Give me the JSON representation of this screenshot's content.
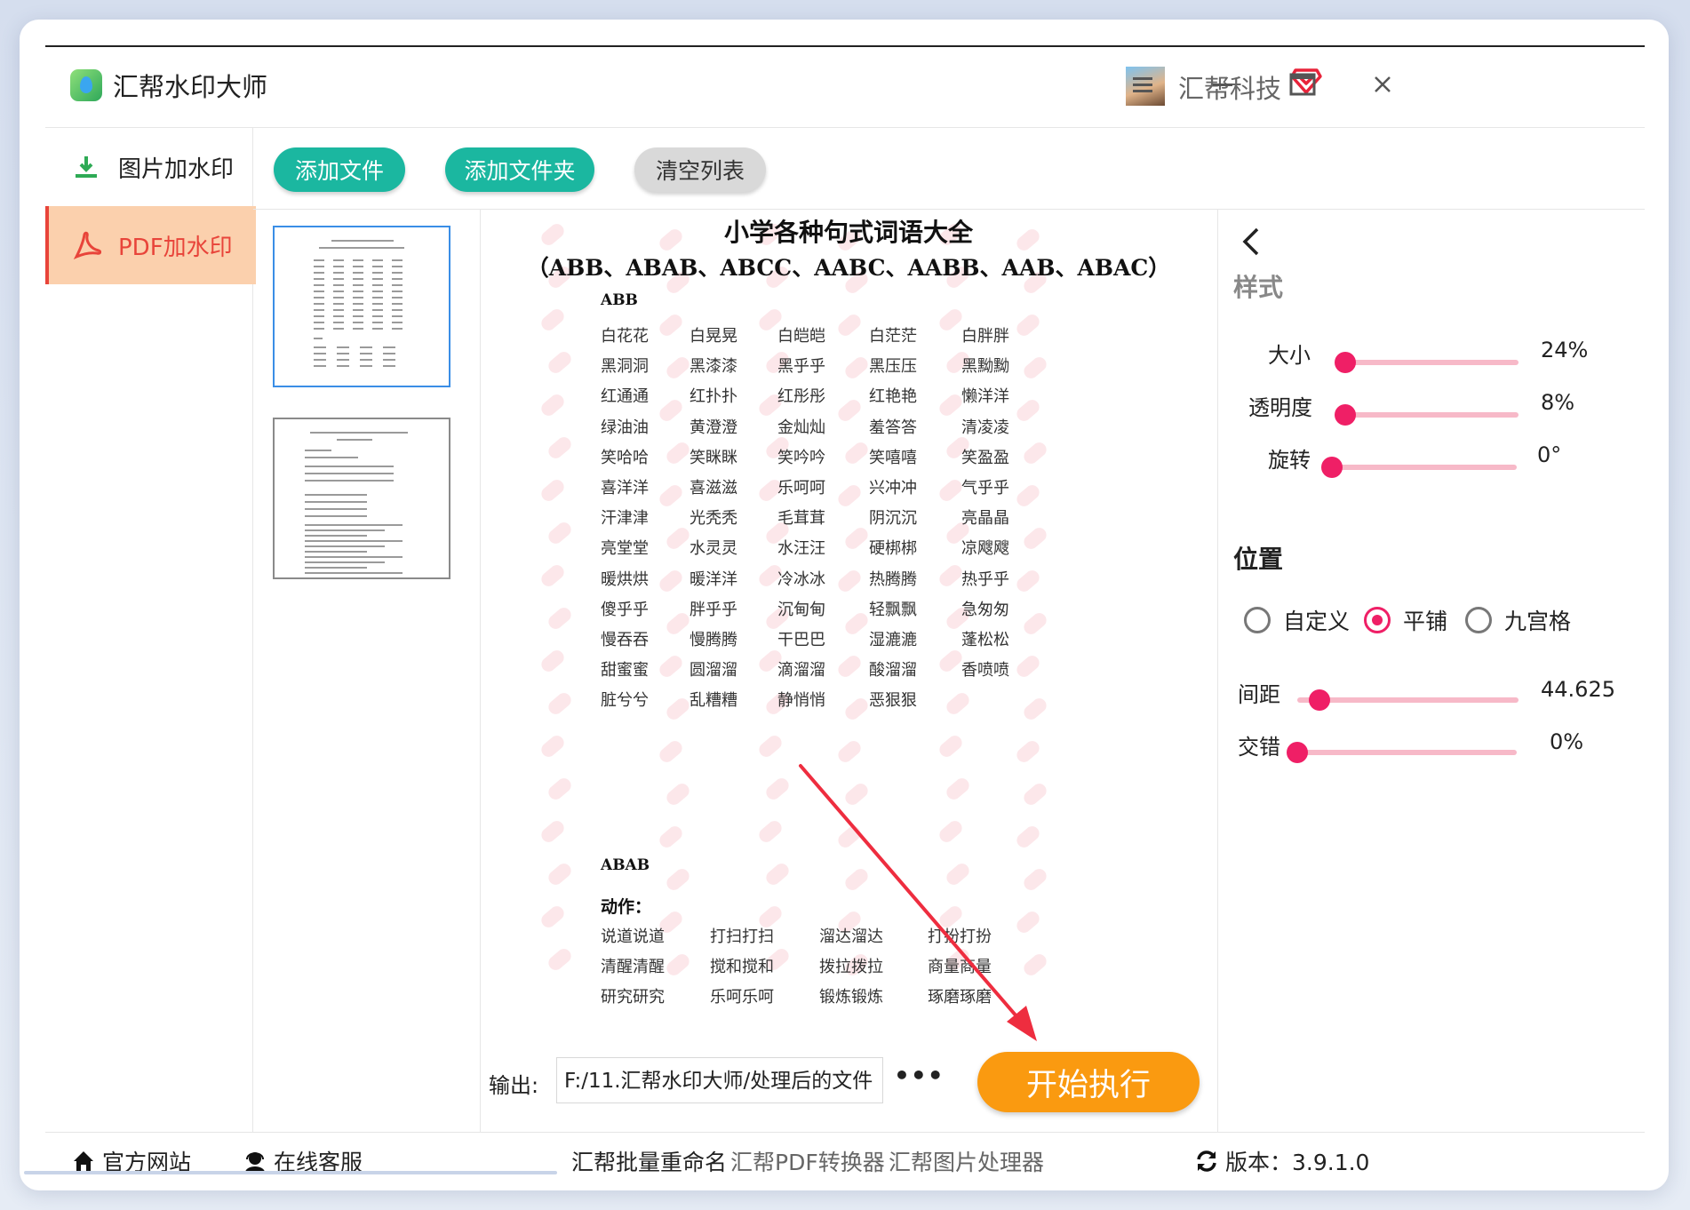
{
  "app": {
    "title": "汇帮水印大师"
  },
  "user": {
    "name": "汇帮科技"
  },
  "sidebar": {
    "items": [
      {
        "label": "图片加水印",
        "active": false
      },
      {
        "label": "PDF加水印",
        "active": true
      }
    ]
  },
  "toolbar": {
    "add_file": "添加文件",
    "add_folder": "添加文件夹",
    "clear_list": "清空列表"
  },
  "document": {
    "title": "小学各种句式词语大全",
    "subtitle": "（ABB、ABAB、ABCC、AABC、AABB、AAB、ABAC）",
    "section_abb": "ABB",
    "abb_words": [
      [
        "白花花",
        "白晃晃",
        "白皑皑",
        "白茫茫",
        "白胖胖"
      ],
      [
        "黑洞洞",
        "黑漆漆",
        "黑乎乎",
        "黑压压",
        "黑黝黝"
      ],
      [
        "红通通",
        "红扑扑",
        "红彤彤",
        "红艳艳",
        "懒洋洋"
      ],
      [
        "绿油油",
        "黄澄澄",
        "金灿灿",
        "羞答答",
        "清凌凌"
      ],
      [
        "笑哈哈",
        "笑眯眯",
        "笑吟吟",
        "笑嘻嘻",
        "笑盈盈"
      ],
      [
        "喜洋洋",
        "喜滋滋",
        "乐呵呵",
        "兴冲冲",
        "气乎乎"
      ],
      [
        "汗津津",
        "光秃秃",
        "毛茸茸",
        "阴沉沉",
        "亮晶晶"
      ],
      [
        "亮堂堂",
        "水灵灵",
        "水汪汪",
        "硬梆梆",
        "凉飕飕"
      ],
      [
        "暖烘烘",
        "暖洋洋",
        "冷冰冰",
        "热腾腾",
        "热乎乎"
      ],
      [
        "傻乎乎",
        "胖乎乎",
        "沉甸甸",
        "轻飘飘",
        "急匆匆"
      ],
      [
        "慢吞吞",
        "慢腾腾",
        "干巴巴",
        "湿漉漉",
        "蓬松松"
      ],
      [
        "甜蜜蜜",
        "圆溜溜",
        "滴溜溜",
        "酸溜溜",
        "香喷喷"
      ],
      [
        "脏兮兮",
        "乱糟糟",
        "静悄悄",
        "恶狠狠",
        ""
      ]
    ],
    "section_abab": "ABAB",
    "abab_sub": "动作：",
    "abab_words": [
      [
        "说道说道",
        "打扫打扫",
        "溜达溜达",
        "打扮打扮"
      ],
      [
        "清醒清醒",
        "搅和搅和",
        "拨拉拨拉",
        "商量商量"
      ],
      [
        "研究研究",
        "乐呵乐呵",
        "锻炼锻炼",
        "琢磨琢磨"
      ]
    ]
  },
  "output": {
    "label": "输出:",
    "path": "F:/11.汇帮水印大师/处理后的文件",
    "more": "•••",
    "start": "开始执行"
  },
  "settings": {
    "style_title": "样式",
    "size": {
      "label": "大小",
      "value": "24%",
      "fraction": 0.05
    },
    "opacity": {
      "label": "透明度",
      "value": "8%",
      "fraction": 0.06
    },
    "rotation": {
      "label": "旋转",
      "value": "0°",
      "fraction": 0.0
    },
    "position_title": "位置",
    "position_options": [
      {
        "label": "自定义",
        "selected": false
      },
      {
        "label": "平铺",
        "selected": true
      },
      {
        "label": "九宫格",
        "selected": false
      }
    ],
    "spacing": {
      "label": "间距",
      "value": "44.625",
      "fraction": 0.1
    },
    "stagger": {
      "label": "交错",
      "value": "0%",
      "fraction": 0.0
    }
  },
  "footer": {
    "website": "官方网站",
    "support": "在线客服",
    "link1": "汇帮批量重命名",
    "link2": "汇帮PDF转换器",
    "link3": "汇帮图片处理器",
    "version": "版本：3.9.1.0"
  },
  "colors": {
    "teal": "#1bb7a0",
    "orange": "#fa9a10",
    "pink": "#ef1f66",
    "active_bg": "#fbd0ad",
    "active_text": "#e8443a"
  }
}
